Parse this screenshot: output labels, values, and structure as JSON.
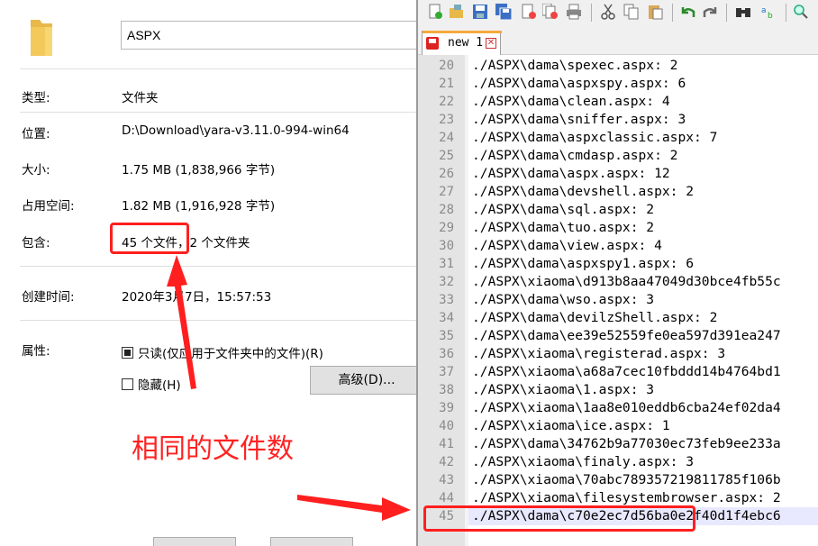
{
  "properties": {
    "folder_name": "ASPX",
    "rows": [
      {
        "label": "类型:",
        "value": "文件夹"
      },
      {
        "label": "位置:",
        "value": "D:\\Download\\yara-v3.11.0-994-win64"
      },
      {
        "label": "大小:",
        "value": "1.75 MB (1,838,966 字节)"
      },
      {
        "label": "占用空间:",
        "value": "1.82 MB (1,916,928 字节)"
      },
      {
        "label": "包含:",
        "value": "45 个文件，2 个文件夹"
      },
      {
        "label": "创建时间:",
        "value": "2020年3月7日，15:57:53"
      }
    ],
    "attributes_label": "属性:",
    "readonly_label": "只读(仅应用于文件夹中的文件)(R)",
    "hidden_label": "隐藏(H)",
    "advanced_button": "高级(D)..."
  },
  "annotation": {
    "caption": "相同的文件数",
    "color": "#ff2222"
  },
  "notepad": {
    "tab_label": "new 1",
    "tab_close": "✕",
    "toolbar_icons": [
      "new-file-icon",
      "open-file-icon",
      "save-icon",
      "save-all-icon",
      "close-icon",
      "close-all-icon",
      "print-icon",
      "cut-icon",
      "copy-icon",
      "paste-icon",
      "undo-icon",
      "redo-icon",
      "find-icon",
      "replace-icon",
      "zoom-in-icon"
    ],
    "current_line": "45",
    "lines": [
      {
        "n": "20",
        "t": "./ASPX\\dama\\spexec.aspx: 2"
      },
      {
        "n": "21",
        "t": "./ASPX\\dama\\aspxspy.aspx: 6"
      },
      {
        "n": "22",
        "t": "./ASPX\\dama\\clean.aspx: 4"
      },
      {
        "n": "23",
        "t": "./ASPX\\dama\\sniffer.aspx: 3"
      },
      {
        "n": "24",
        "t": "./ASPX\\dama\\aspxclassic.aspx: 7"
      },
      {
        "n": "25",
        "t": "./ASPX\\dama\\cmdasp.aspx: 2"
      },
      {
        "n": "26",
        "t": "./ASPX\\dama\\aspx.aspx: 12"
      },
      {
        "n": "27",
        "t": "./ASPX\\dama\\devshell.aspx: 2"
      },
      {
        "n": "28",
        "t": "./ASPX\\dama\\sql.aspx: 2"
      },
      {
        "n": "29",
        "t": "./ASPX\\dama\\tuo.aspx: 2"
      },
      {
        "n": "30",
        "t": "./ASPX\\dama\\view.aspx: 4"
      },
      {
        "n": "31",
        "t": "./ASPX\\dama\\aspxspy1.aspx: 6"
      },
      {
        "n": "32",
        "t": "./ASPX\\xiaoma\\d913b8aa47049d30bce4fb55c"
      },
      {
        "n": "33",
        "t": "./ASPX\\dama\\wso.aspx: 3"
      },
      {
        "n": "34",
        "t": "./ASPX\\dama\\devilzShell.aspx: 2"
      },
      {
        "n": "35",
        "t": "./ASPX\\dama\\ee39e52559fe0ea597d391ea247"
      },
      {
        "n": "36",
        "t": "./ASPX\\xiaoma\\registerad.aspx: 3"
      },
      {
        "n": "37",
        "t": "./ASPX\\xiaoma\\a68a7cec10fbddd14b4764bd1"
      },
      {
        "n": "38",
        "t": "./ASPX\\xiaoma\\1.aspx: 3"
      },
      {
        "n": "39",
        "t": "./ASPX\\xiaoma\\1aa8e010eddb6cba24ef02da4"
      },
      {
        "n": "40",
        "t": "./ASPX\\xiaoma\\ice.aspx: 1"
      },
      {
        "n": "41",
        "t": "./ASPX\\dama\\34762b9a77030ec73feb9ee233a"
      },
      {
        "n": "42",
        "t": "./ASPX\\xiaoma\\finaly.aspx: 3"
      },
      {
        "n": "43",
        "t": "./ASPX\\xiaoma\\70abc789357219811785f106b"
      },
      {
        "n": "44",
        "t": "./ASPX\\xiaoma\\filesystembrowser.aspx: 2"
      },
      {
        "n": "45",
        "t": "./ASPX\\dama\\c70e2ec7d56ba0e2f40d1f4ebc6"
      }
    ]
  }
}
